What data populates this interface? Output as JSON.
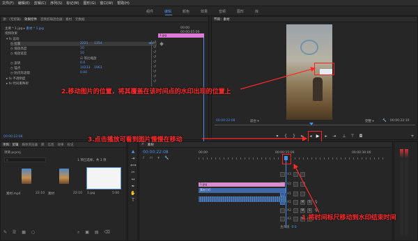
{
  "menu": [
    "文件(F)",
    "编辑(E)",
    "剪辑(C)",
    "序列(S)",
    "标记(M)",
    "图形(G)",
    "窗口(W)",
    "帮助(H)"
  ],
  "workspaces": {
    "items": [
      "组件",
      "编辑",
      "颜色",
      "效果",
      "音频",
      "图形",
      "库"
    ],
    "active": 1
  },
  "effect_controls": {
    "tabs": [
      "源：(无剪辑)",
      "效果控件",
      "音频剪辑混合器：素材",
      "元数据"
    ],
    "clip_header": "主要 * 1.jpg",
    "clip_sel": "素材 * 1.jpg",
    "timecode_in": "00:00",
    "timecode_out": "00:00:05:00",
    "clip_label": "1.jpg",
    "section": "视频效果",
    "motion": "运动",
    "props": [
      {
        "name": "位置",
        "v1": "2221",
        "v2": "1354"
      },
      {
        "name": "缩放高度",
        "v1": "10",
        "v2": ""
      },
      {
        "name": "缩放宽度",
        "v1": "10",
        "v2": ""
      },
      {
        "name": "等比缩放",
        "v1": "",
        "v2": ""
      },
      {
        "name": "旋转",
        "v1": "0.0",
        "v2": ""
      },
      {
        "name": "锚点",
        "v1": "10233",
        "v2": "1963"
      },
      {
        "name": "防闪烁滤镜",
        "v1": "0.00",
        "v2": ""
      }
    ],
    "opacity": "不透明度",
    "remap": "时间重映射",
    "current_time": "00:00:22:08"
  },
  "program": {
    "tab": "节目：素材",
    "timecode": "00:00:22:08",
    "fit": "适合",
    "quality": "完整",
    "duration": "00:00:22:10"
  },
  "project": {
    "tabs": [
      "项目：剪辑",
      "媒体浏览器",
      "库",
      "信息",
      "效果",
      "标记"
    ],
    "filename": "项目.prproj",
    "items_count": "1 项已选择，共 3 项",
    "items": [
      {
        "name": "素材.mp4",
        "dur": "22:10"
      },
      {
        "name": "素材",
        "dur": "22:10"
      },
      {
        "name": "1.jpg",
        "dur": "5:00"
      }
    ]
  },
  "timeline": {
    "tab": "素材",
    "timecode": "00:00:22:08",
    "ruler": [
      "00:00",
      "00:00:15:00",
      "00:00:30:00"
    ],
    "v3": "V3",
    "v2": "V2",
    "v1": "V1",
    "a1": "A1",
    "a2": "A2",
    "a3": "A3",
    "clip_img": "1.jpg",
    "clip_video": "素材 [V]",
    "master": "主声道",
    "master_val": "0.0"
  },
  "annotations": {
    "a1": "1.将时间标尺移动到水印结束时间",
    "a2": "2.移动图片的位置，将其覆盖在该时间点的水印出现的位置上",
    "a3": "3.点击播放可看到图片慢慢在移动"
  },
  "colors": {
    "accent": "#4a8fe8",
    "annotation": "#ff2a2a",
    "clip_pink": "#e07ad8",
    "clip_video": "#3f69a8"
  }
}
